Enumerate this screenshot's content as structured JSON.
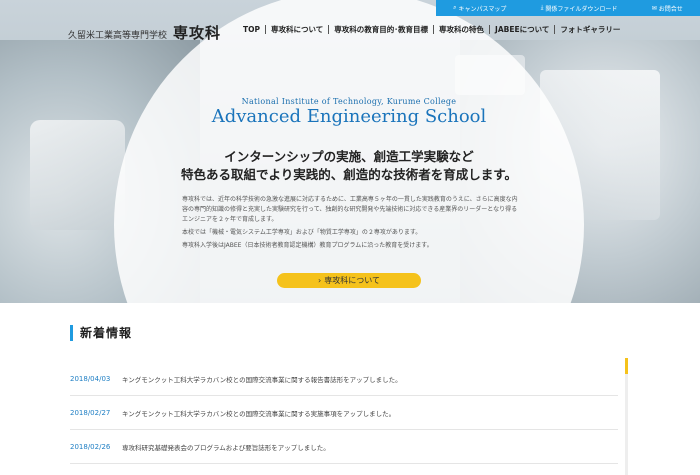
{
  "utility": {
    "items": [
      {
        "icon": "search-icon",
        "label": "キャンパスマップ"
      },
      {
        "icon": "download-icon",
        "label": "関係ファイルダウンロード"
      },
      {
        "icon": "mail-icon",
        "label": "お問合せ"
      }
    ]
  },
  "logo": {
    "sub": "久留米工業高等専門学校",
    "main": "専攻科"
  },
  "nav": {
    "items": [
      {
        "label": "TOP"
      },
      {
        "label": "専攻科について"
      },
      {
        "label": "専攻科の教育目的･教育目標"
      },
      {
        "label": "専攻科の特色"
      },
      {
        "label": "JABEEについて"
      },
      {
        "label": "フォトギャラリー"
      }
    ]
  },
  "hero": {
    "en_sub": "National Institute of Technology, Kurume College",
    "en_title": "Advanced Engineering School",
    "jp_line1": "インターンシップの実施、創造工学実験など",
    "jp_line2": "特色ある取組でより実践的、創造的な技術者を育成します。",
    "body": [
      "専攻科では、近年の科学技術の急激な進展に対応するために、工業高専５ヶ年の一貫した実践教育のうえに、さらに高度な内容の専門的知識の修得と充実した実験研究を行って、独創的な研究開発や先端技術に対応できる産業界のリーダーとなり得るエンジニアを２ヶ年で育成します。",
      "本校では「機械・電気システム工学専攻」および「物質工学専攻」の２専攻があります。",
      "専攻科入学後はJABEE（日本技術者教育認定機構）教育プログラムに沿った教育を受けます。"
    ],
    "cta_label": "専攻科について",
    "cta_icon": "chevron-right-icon"
  },
  "news": {
    "heading": "新着情報",
    "items": [
      {
        "date": "2018/04/03",
        "text": "キングモンクット工科大学ラカバン校との国際交流事業に関する報告書誌形をアップしました。"
      },
      {
        "date": "2018/02/27",
        "text": "キングモンクット工科大学ラカバン校との国際交流事業に関する実施事項をアップしました。"
      },
      {
        "date": "2018/02/26",
        "text": "専攻科研究基礎発表会のプログラムおよび要旨誌形をアップしました。"
      }
    ]
  },
  "colors": {
    "accent": "#1f9be0",
    "cta": "#f5c21b",
    "title_blue": "#1a74bb"
  }
}
